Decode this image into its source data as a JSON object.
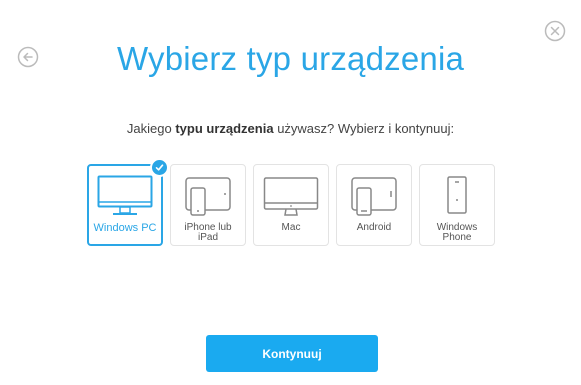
{
  "title": "Wybierz typ urządzenia",
  "subtitle": {
    "prefix": "Jakiego ",
    "bold": "typu urządzenia",
    "suffix": " używasz? Wybierz i kontynuuj:"
  },
  "devices": [
    {
      "label": "Windows PC",
      "icon": "monitor-icon",
      "selected": true
    },
    {
      "label": "iPhone lub\niPad",
      "icon": "tablet-phone-icon",
      "selected": false
    },
    {
      "label": "Mac",
      "icon": "imac-icon",
      "selected": false
    },
    {
      "label": "Android",
      "icon": "android-tablet-phone-icon",
      "selected": false
    },
    {
      "label": "Windows\nPhone",
      "icon": "phone-icon",
      "selected": false
    }
  ],
  "button": {
    "label": "Kontynuuj"
  },
  "colors": {
    "accent": "#2aa6e6",
    "button": "#1aaaf0",
    "icon_gray": "#888888"
  }
}
